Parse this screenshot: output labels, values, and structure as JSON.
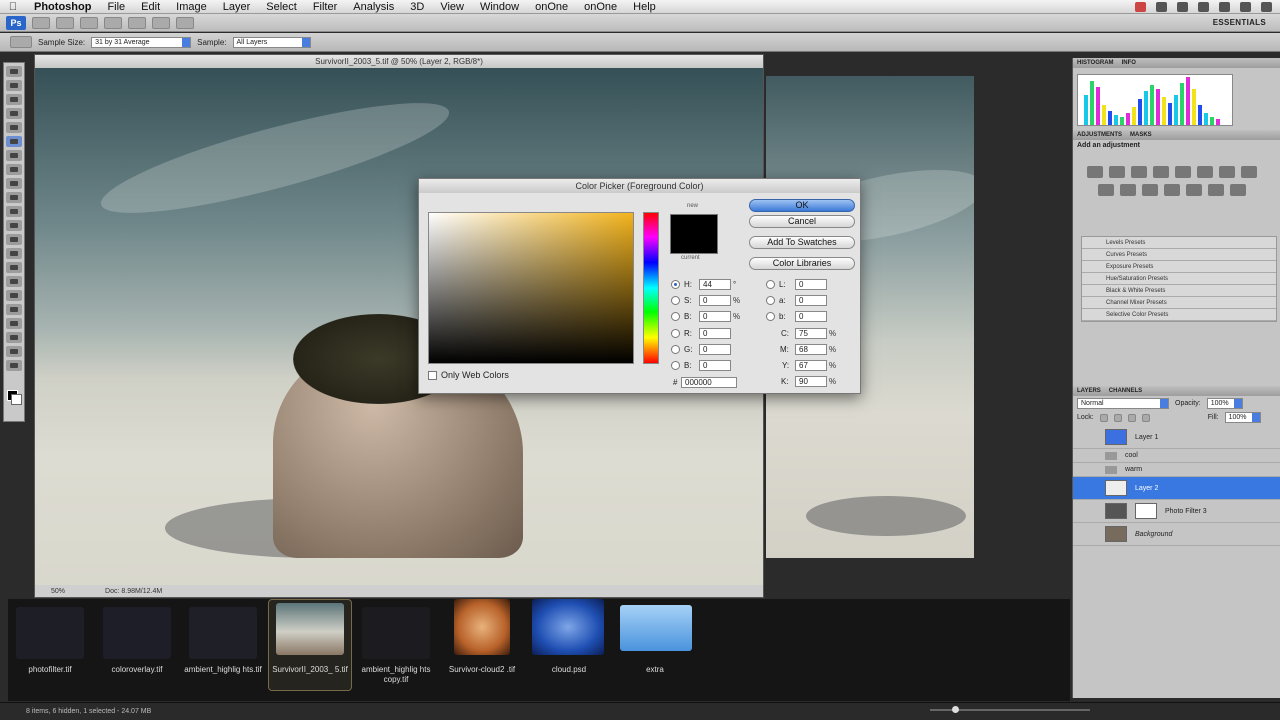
{
  "menubar": {
    "app": "Photoshop",
    "items": [
      "File",
      "Edit",
      "Image",
      "Layer",
      "Select",
      "Filter",
      "Analysis",
      "3D",
      "View",
      "Window",
      "onOne",
      "onOne",
      "Help"
    ]
  },
  "appbar": {
    "badge": "Ps",
    "workspace": "ESSENTIALS"
  },
  "options": {
    "sample_size_label": "Sample Size:",
    "sample_size_value": "31 by 31 Average",
    "sample_label": "Sample:",
    "sample_value": "All Layers"
  },
  "document": {
    "title": "SurvivorII_2003_5.tif @ 50% (Layer 2, RGB/8*)",
    "zoom": "50%",
    "doc_size": "Doc: 8.98M/12.4M"
  },
  "panels": {
    "tabs_top": [
      "HISTOGRAM",
      "INFO"
    ],
    "tabs_adj": [
      "ADJUSTMENTS",
      "MASKS"
    ],
    "add_adjustment": "Add an adjustment",
    "presets": [
      "Levels Presets",
      "Curves Presets",
      "Exposure Presets",
      "Hue/Saturation Presets",
      "Black & White Presets",
      "Channel Mixer Presets",
      "Selective Color Presets"
    ],
    "tabs_layers": [
      "LAYERS",
      "CHANNELS"
    ],
    "blend_mode": "Normal",
    "opacity_label": "Opacity:",
    "opacity": "100%",
    "lock_label": "Lock:",
    "fill_label": "Fill:",
    "fill": "100%",
    "layers": [
      "Layer 1",
      "cool",
      "warm",
      "Layer 2",
      "Photo Filter 3",
      "Background"
    ]
  },
  "picker": {
    "title": "Color Picker (Foreground Color)",
    "new_label": "new",
    "current_label": "current",
    "ok": "OK",
    "cancel": "Cancel",
    "add_swatches": "Add To Swatches",
    "color_libraries": "Color Libraries",
    "only_web": "Only Web Colors",
    "H": "44",
    "S": "0",
    "B": "0",
    "R": "0",
    "G": "0",
    "B2": "0",
    "L": "0",
    "a": "0",
    "b": "0",
    "C": "75",
    "M": "68",
    "Y": "67",
    "K": "90",
    "hex": "000000",
    "labels": {
      "H": "H:",
      "S": "S:",
      "B": "B:",
      "R": "R:",
      "G": "G:",
      "B2": "B:",
      "L": "L:",
      "a": "a:",
      "b": "b:",
      "C": "C:",
      "M": "M:",
      "Y": "Y:",
      "K": "K:",
      "hash": "#"
    },
    "units": {
      "deg": "°",
      "pct": "%"
    }
  },
  "files": [
    {
      "name": "photofilter.tif"
    },
    {
      "name": "coloroverlay.tif"
    },
    {
      "name": "ambient_highlig hts.tif"
    },
    {
      "name": "SurvivorII_2003_ 5.tif"
    },
    {
      "name": "ambient_highlig hts copy.tif"
    },
    {
      "name": "Survivor-cloud2 .tif"
    },
    {
      "name": "cloud.psd"
    },
    {
      "name": "extra"
    }
  ],
  "statusbar": "8 items, 6 hidden, 1 selected - 24.07 MB",
  "colors": {
    "accent": "#3878e0",
    "selection": "#2a62c9"
  }
}
